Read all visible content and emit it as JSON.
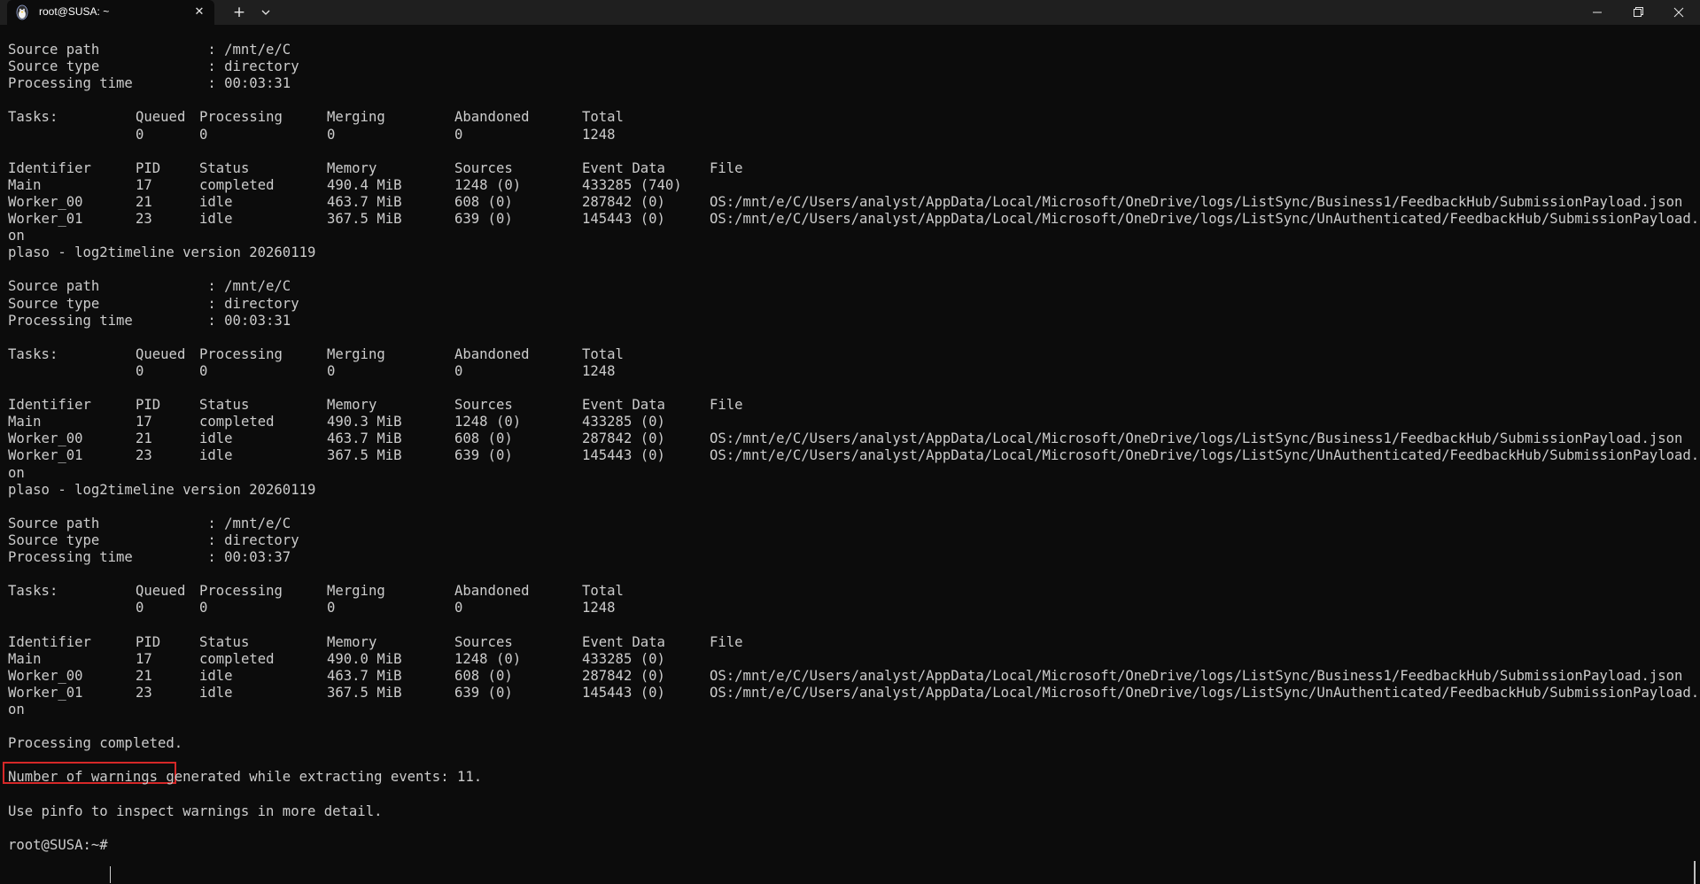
{
  "window": {
    "tab_title": "root@SUSA: ~",
    "tab_close": "✕",
    "new_tab": "+"
  },
  "blocks": [
    {
      "source_path": "Source path             : /mnt/e/C",
      "source_type": "Source type             : directory",
      "processing_time": "Processing time         : 00:03:31",
      "tasks_header": [
        "Tasks:",
        "Queued",
        "Processing",
        "Merging",
        "Abandoned",
        "Total"
      ],
      "tasks_values": [
        "",
        "0",
        "0",
        "0",
        "0",
        "1248"
      ],
      "proc_header": [
        "Identifier",
        "PID",
        "Status",
        "Memory",
        "Sources",
        "Event Data",
        "File"
      ],
      "rows": [
        [
          "Main",
          "17",
          "completed",
          "490.4 MiB",
          "1248 (0)",
          "433285 (740)",
          ""
        ],
        [
          "Worker_00",
          "21",
          "idle",
          "463.7 MiB",
          "608 (0)",
          "287842 (0)",
          "OS:/mnt/e/C/Users/analyst/AppData/Local/Microsoft/OneDrive/logs/ListSync/Business1/FeedbackHub/SubmissionPayload.json"
        ],
        [
          "Worker_01",
          "23",
          "idle",
          "367.5 MiB",
          "639 (0)",
          "145443 (0)",
          "OS:/mnt/e/C/Users/analyst/AppData/Local/Microsoft/OneDrive/logs/ListSync/UnAuthenticated/FeedbackHub/SubmissionPayload.js"
        ]
      ],
      "wrap": "on",
      "version": "plaso - log2timeline version 20260119"
    },
    {
      "source_path": "Source path             : /mnt/e/C",
      "source_type": "Source type             : directory",
      "processing_time": "Processing time         : 00:03:31",
      "tasks_header": [
        "Tasks:",
        "Queued",
        "Processing",
        "Merging",
        "Abandoned",
        "Total"
      ],
      "tasks_values": [
        "",
        "0",
        "0",
        "0",
        "0",
        "1248"
      ],
      "proc_header": [
        "Identifier",
        "PID",
        "Status",
        "Memory",
        "Sources",
        "Event Data",
        "File"
      ],
      "rows": [
        [
          "Main",
          "17",
          "completed",
          "490.3 MiB",
          "1248 (0)",
          "433285 (0)",
          ""
        ],
        [
          "Worker_00",
          "21",
          "idle",
          "463.7 MiB",
          "608 (0)",
          "287842 (0)",
          "OS:/mnt/e/C/Users/analyst/AppData/Local/Microsoft/OneDrive/logs/ListSync/Business1/FeedbackHub/SubmissionPayload.json"
        ],
        [
          "Worker_01",
          "23",
          "idle",
          "367.5 MiB",
          "639 (0)",
          "145443 (0)",
          "OS:/mnt/e/C/Users/analyst/AppData/Local/Microsoft/OneDrive/logs/ListSync/UnAuthenticated/FeedbackHub/SubmissionPayload.js"
        ]
      ],
      "wrap": "on",
      "version": "plaso - log2timeline version 20260119"
    },
    {
      "source_path": "Source path             : /mnt/e/C",
      "source_type": "Source type             : directory",
      "processing_time": "Processing time         : 00:03:37",
      "tasks_header": [
        "Tasks:",
        "Queued",
        "Processing",
        "Merging",
        "Abandoned",
        "Total"
      ],
      "tasks_values": [
        "",
        "0",
        "0",
        "0",
        "0",
        "1248"
      ],
      "proc_header": [
        "Identifier",
        "PID",
        "Status",
        "Memory",
        "Sources",
        "Event Data",
        "File"
      ],
      "rows": [
        [
          "Main",
          "17",
          "completed",
          "490.0 MiB",
          "1248 (0)",
          "433285 (0)",
          ""
        ],
        [
          "Worker_00",
          "21",
          "idle",
          "463.7 MiB",
          "608 (0)",
          "287842 (0)",
          "OS:/mnt/e/C/Users/analyst/AppData/Local/Microsoft/OneDrive/logs/ListSync/Business1/FeedbackHub/SubmissionPayload.json"
        ],
        [
          "Worker_01",
          "23",
          "idle",
          "367.5 MiB",
          "639 (0)",
          "145443 (0)",
          "OS:/mnt/e/C/Users/analyst/AppData/Local/Microsoft/OneDrive/logs/ListSync/UnAuthenticated/FeedbackHub/SubmissionPayload.js"
        ]
      ],
      "wrap": "on",
      "version": ""
    }
  ],
  "footer": {
    "completed": "Processing completed.",
    "warnings": "Number of warnings generated while extracting events: 11.",
    "hint": "Use pinfo to inspect warnings in more detail.",
    "prompt": "root@SUSA:~#"
  },
  "colors": {
    "background": "#0c0c0c",
    "text": "#cccccc",
    "highlight_border": "#d62828",
    "titlebar": "#1f1f1f"
  }
}
